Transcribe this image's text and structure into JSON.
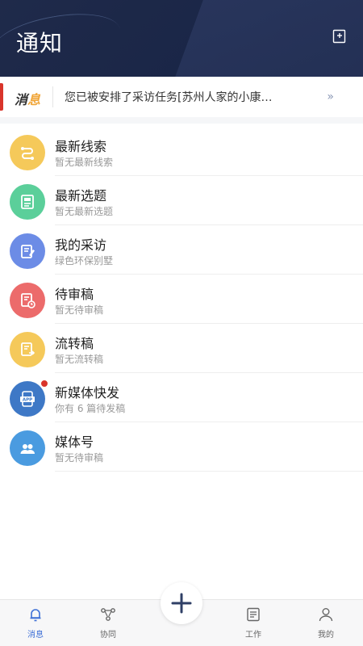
{
  "header": {
    "title": "通知",
    "edit_icon": "edit-icon"
  },
  "message_bar": {
    "logo_part1": "消",
    "logo_part2": "息",
    "text": "您已被安排了采访任务[苏州人家的小康…",
    "more_symbol": "»",
    "accent": "#d9342b"
  },
  "items": [
    {
      "name": "最新线索",
      "sub": "暂无最新线索",
      "icon": "clue-icon",
      "color": "#f5c95a"
    },
    {
      "name": "最新选题",
      "sub": "暂无最新选题",
      "icon": "topic-icon",
      "color": "#5bcf9a"
    },
    {
      "name": "我的采访",
      "sub": "绿色环保别墅",
      "icon": "interview-icon",
      "color": "#6c8ce6"
    },
    {
      "name": "待审稿",
      "sub": "暂无待审稿",
      "icon": "review-icon",
      "color": "#ec6b6b"
    },
    {
      "name": "流转稿",
      "sub": "暂无流转稿",
      "icon": "transfer-icon",
      "color": "#f5c95a"
    },
    {
      "name": "新媒体快发",
      "sub": "你有 6 篇待发稿",
      "icon": "app-icon",
      "color": "#3e78c6",
      "badge": true
    },
    {
      "name": "媒体号",
      "sub": "暂无待审稿",
      "icon": "media-account-icon",
      "color": "#4a9be0"
    }
  ],
  "tabbar": {
    "tabs": [
      {
        "label": "消息",
        "icon": "bell-icon",
        "active": true
      },
      {
        "label": "协同",
        "icon": "collaborate-icon",
        "active": false
      },
      {
        "label": "工作",
        "icon": "work-icon",
        "active": false
      },
      {
        "label": "我的",
        "icon": "profile-icon",
        "active": false
      }
    ],
    "fab_icon": "plus-icon",
    "active_color": "#3d6fd6"
  }
}
